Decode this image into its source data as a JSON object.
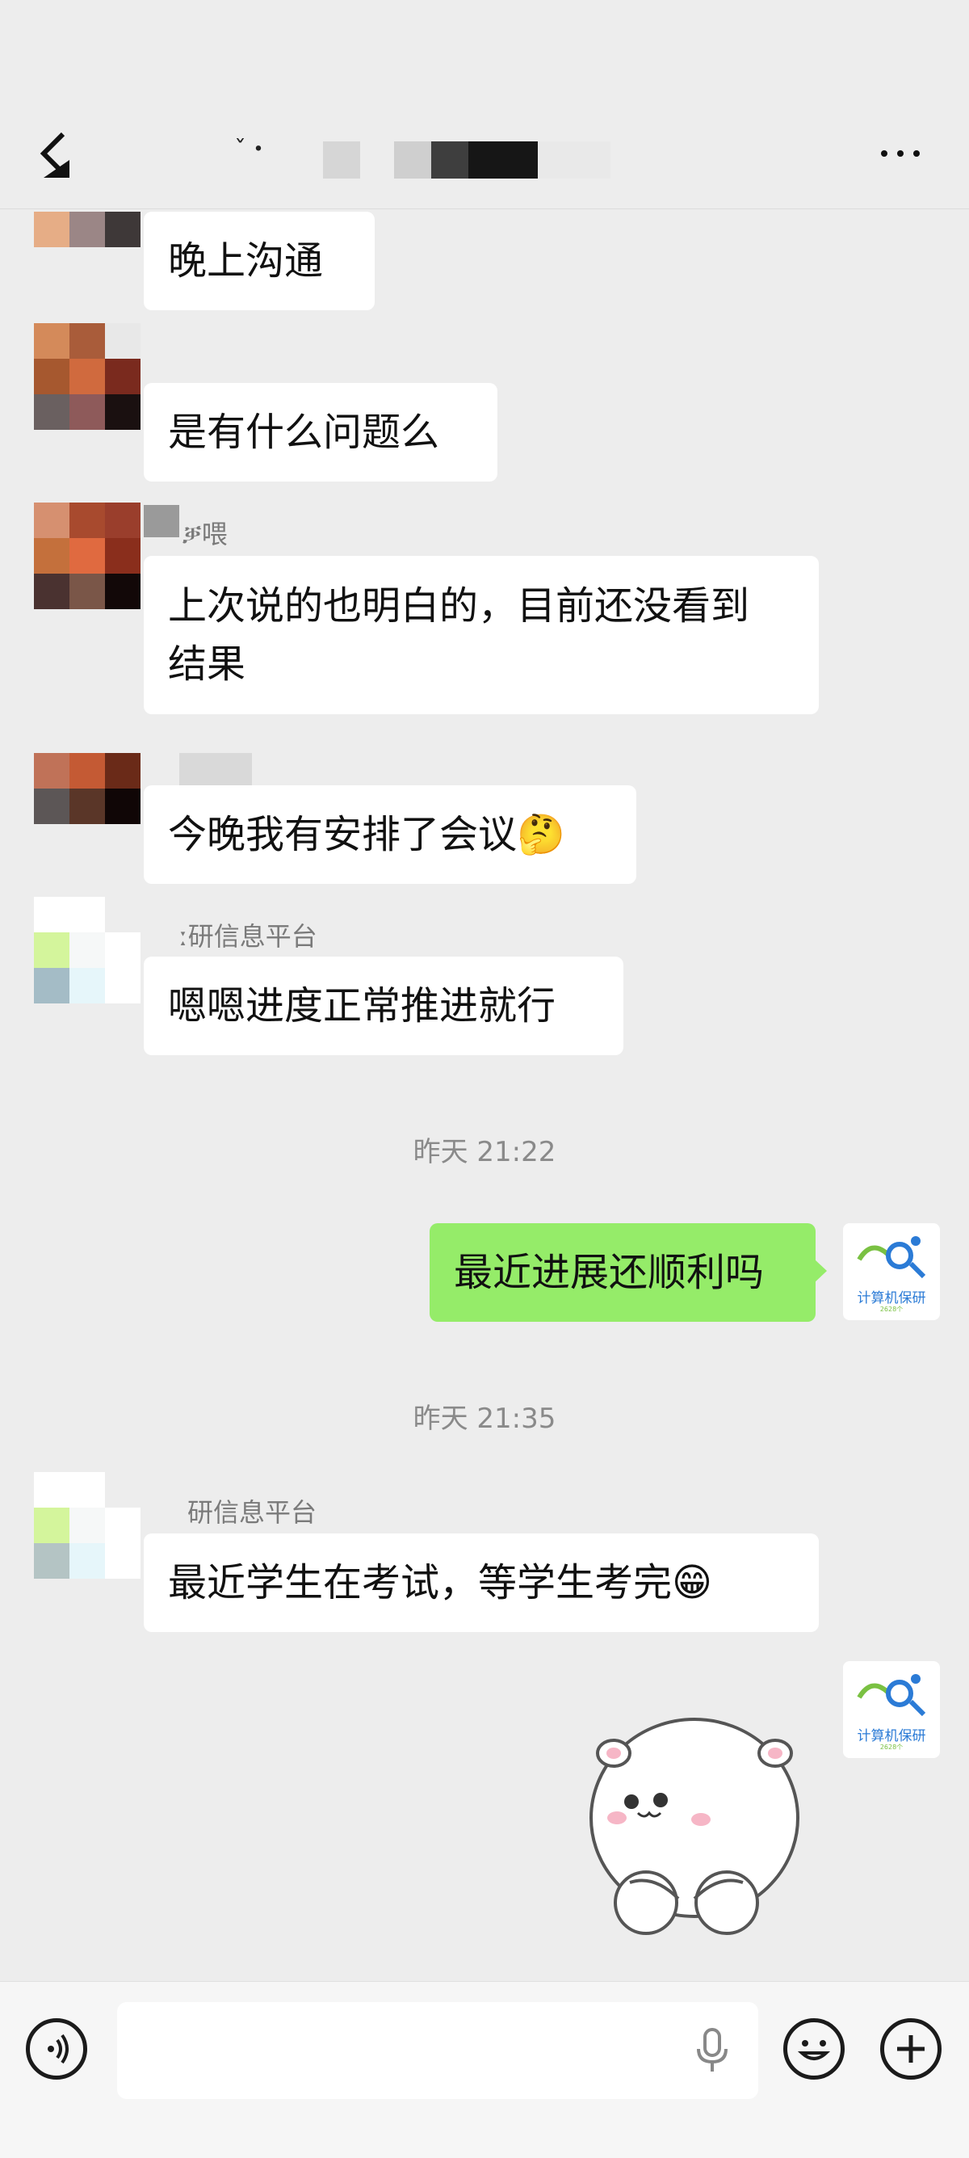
{
  "header": {
    "title_visible": "ˇ・",
    "back_label": "back",
    "more_label": "···"
  },
  "messages": [
    {
      "text": "晚上沟通"
    },
    {
      "text": "是有什么问题么"
    },
    {
      "name": "ቓ喂",
      "text_line1": "上次说的也明白的，目前还没看到",
      "text_line2": "结果"
    },
    {
      "text": "今晚我有安排了会议",
      "emoji": "🤔"
    },
    {
      "name": "ː研信息平台",
      "text": "嗯嗯进度正常推进就行"
    }
  ],
  "time1": "昨天 21:22",
  "self_message": {
    "text": "最近进展还顺利吗"
  },
  "time2": "昨天 21:35",
  "reply": {
    "name": "研信息平台",
    "text": "最近学生在考试，等学生考完",
    "emoji": "😁"
  },
  "self_avatar": {
    "caption": "计算机保研",
    "sub": "2628个"
  },
  "colors": {
    "background": "#ededed",
    "self_bubble": "#95ec69",
    "other_bubble": "#ffffff",
    "avatar_accent": "#2b7bd6"
  },
  "icons": [
    "back-icon",
    "more-icon",
    "voice-icon",
    "microphone-icon",
    "emoji-icon",
    "plus-icon"
  ]
}
